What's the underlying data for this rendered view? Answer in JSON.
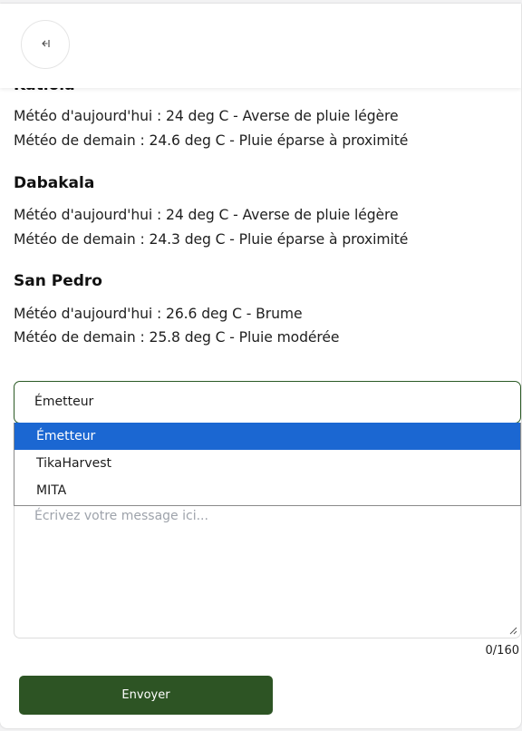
{
  "header": {
    "back_icon": "collapse-left-icon"
  },
  "forecast": [
    {
      "city": "Katiola",
      "today": "Météo d'aujourd'hui : 24 deg C - Averse de pluie légère",
      "tomorrow": "Météo de demain : 24.6 deg C - Pluie éparse à proximité"
    },
    {
      "city": "Dabakala",
      "today": "Météo d'aujourd'hui : 24 deg C - Averse de pluie légère",
      "tomorrow": "Météo de demain : 24.3 deg C - Pluie éparse à proximité"
    },
    {
      "city": "San Pedro",
      "today": "Météo d'aujourd'hui : 26.6 deg C - Brume",
      "tomorrow": "Météo de demain : 25.8 deg C - Pluie modérée"
    }
  ],
  "form": {
    "sender_select": {
      "value": "Émetteur",
      "options": [
        "Émetteur",
        "TikaHarvest",
        "MITA"
      ],
      "selected_index": 0
    },
    "message": {
      "placeholder": "Écrivez votre message ici...",
      "counter": "0/160"
    },
    "send_label": "Envoyer"
  },
  "colors": {
    "accent_green": "#2d5424",
    "select_border": "#2b5a25",
    "option_highlight": "#1b67d2"
  }
}
